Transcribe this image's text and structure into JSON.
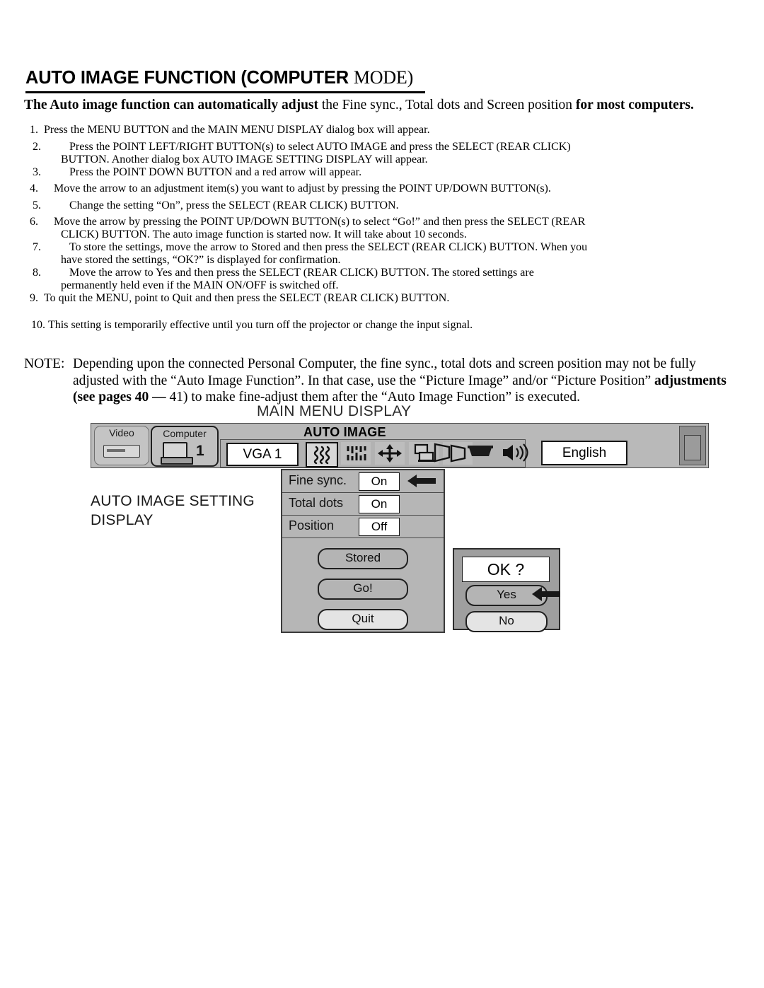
{
  "document": {
    "title_main": "AUTO IMAGE FUNCTION (COMPUTER ",
    "title_mode": "MODE)",
    "subtitle_bold_1": "The Auto image function can automatically adjust ",
    "subtitle_plain_1": "the Fine sync., Total dots and Screen position ",
    "subtitle_bold_2": "for most computers."
  },
  "steps": [
    {
      "num": "1.",
      "text": "Press the MENU BUTTON and the MAIN MENU DISPLAY dialog box will appear."
    },
    {
      "num": "2.",
      "text": "Press the POINT LEFT/RIGHT BUTTON(s) to select AUTO IMAGE and press the SELECT (REAR CLICK)",
      "cont": "BUTTON. Another dialog box AUTO IMAGE SETTING DISPLAY will appear."
    },
    {
      "num": "3.",
      "text": "Press the POINT DOWN BUTTON and a red arrow will appear."
    },
    {
      "num": "4.",
      "text": "Move the arrow to an adjustment item(s) you want to adjust by pressing the POINT UP/DOWN BUTTON(s)."
    },
    {
      "num": "5.",
      "text": "Change the setting “On”, press the SELECT (REAR CLICK) BUTTON."
    },
    {
      "num": "6.",
      "text": "Move the arrow by pressing the POINT UP/DOWN BUTTON(s) to select “Go!” and then press the SELECT (REAR",
      "cont": "CLICK) BUTTON. The auto image function is started now. It will take about 10 seconds."
    },
    {
      "num": "7.",
      "text": "To store the settings, move the arrow to Stored and then press the SELECT (REAR CLICK) BUTTON. When you",
      "cont": "have stored the settings, “OK?” is displayed for confirmation."
    },
    {
      "num": "8.",
      "text": "Move the arrow to Yes and then press the SELECT (REAR CLICK) BUTTON. The stored settings are",
      "cont": "permanently held even if the MAIN ON/OFF is switched off."
    },
    {
      "num": "9.",
      "text": "To quit the MENU, point to Quit and then press the SELECT (REAR CLICK) BUTTON."
    },
    {
      "num": "10.",
      "text": "This setting is temporarily effective until you turn off the projector or change the input signal."
    }
  ],
  "note": {
    "label": "NOTE:",
    "line1": "Depending upon the connected Personal Computer, the fine sync., total dots and screen position may not be fully",
    "line2a": "adjusted with the “Auto Image Function”. In that case, use the “Picture Image” and/or “Picture Position” ",
    "line2b": "adjustments",
    "line3a": "(see pages 40 — ",
    "line3b": "41) to make fine-adjust them after the “Auto Image Function” is executed."
  },
  "figure": {
    "caption": "MAIN MENU DISPLAY",
    "left_label_line1": "AUTO IMAGE SETTING",
    "left_label_line2": "DISPLAY",
    "menubar": {
      "video_label": "Video",
      "computer_label": "Computer",
      "computer_number": "1",
      "menu_title": "AUTO IMAGE",
      "source_value": "VGA 1",
      "language_value": "English",
      "icons": [
        {
          "name": "fine-sync-icon",
          "selected": true
        },
        {
          "name": "total-dots-icon",
          "selected": false
        },
        {
          "name": "position-icon",
          "selected": false
        },
        {
          "name": "picture-image-icon",
          "selected": false
        },
        {
          "name": "keystone-icon",
          "selected": false
        }
      ],
      "right_icons": [
        {
          "name": "screen-keystone-icon"
        },
        {
          "name": "picture-screen-icon"
        },
        {
          "name": "volume-icon"
        }
      ]
    },
    "setting_panel": {
      "rows": [
        {
          "label": "Fine sync.",
          "value": "On",
          "arrow": true
        },
        {
          "label": "Total dots",
          "value": "On",
          "arrow": false
        },
        {
          "label": "Position",
          "value": "Off",
          "arrow": false
        }
      ],
      "buttons": [
        {
          "label": "Stored",
          "highlighted": false
        },
        {
          "label": "Go!",
          "highlighted": false
        },
        {
          "label": "Quit",
          "highlighted": true
        }
      ]
    },
    "ok_dialog": {
      "prompt": "OK ?",
      "buttons": [
        {
          "label": "Yes",
          "highlighted": false,
          "arrow": true
        },
        {
          "label": "No",
          "highlighted": true,
          "arrow": false
        }
      ]
    }
  },
  "colors": {
    "page_bg": "#ffffff",
    "text": "#000000",
    "panel_gray": "#b6b6b6",
    "menubar_gray": "#b9b9b9",
    "dialog_gray": "#9f9f9f",
    "border_dark": "#2c2c2c"
  }
}
